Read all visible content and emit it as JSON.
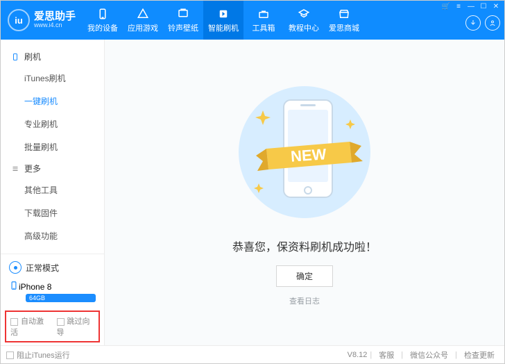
{
  "header": {
    "logo_text": "iu",
    "logo_title": "爱思助手",
    "logo_sub": "www.i4.cn",
    "nav": [
      {
        "label": "我的设备",
        "icon": "device"
      },
      {
        "label": "应用游戏",
        "icon": "apps"
      },
      {
        "label": "铃声壁纸",
        "icon": "ringtone"
      },
      {
        "label": "智能刷机",
        "icon": "flash"
      },
      {
        "label": "工具箱",
        "icon": "toolbox"
      },
      {
        "label": "教程中心",
        "icon": "tutorial"
      },
      {
        "label": "爱思商城",
        "icon": "shop"
      }
    ],
    "active_nav_index": 3
  },
  "sidebar": {
    "sections": [
      {
        "title": "刷机",
        "icon": "phone",
        "items": [
          "iTunes刷机",
          "一键刷机",
          "专业刷机",
          "批量刷机"
        ],
        "active_item_index": 1
      },
      {
        "title": "更多",
        "icon": "bars",
        "items": [
          "其他工具",
          "下载固件",
          "高级功能"
        ],
        "active_item_index": -1
      }
    ],
    "mode": "正常模式",
    "device_name": "iPhone 8",
    "device_capacity": "64GB",
    "checkbox_auto_activate": "自动激活",
    "checkbox_skip_guide": "跳过向导"
  },
  "main": {
    "banner_text": "NEW",
    "success_title": "恭喜您，保资料刷机成功啦！",
    "ok_button": "确定",
    "view_log": "查看日志"
  },
  "footer": {
    "checkbox_prevent_itunes": "阻止iTunes运行",
    "version": "V8.12",
    "links": [
      "客服",
      "微信公众号",
      "检查更新"
    ]
  }
}
